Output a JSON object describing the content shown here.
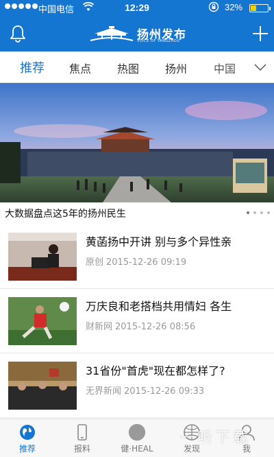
{
  "status_bar": {
    "carrier": "中国电信",
    "time": "12:29",
    "battery_percent": "32%",
    "battery_level": 0.32,
    "battery_fill_color": "#f2d200"
  },
  "header": {
    "logo_title": "扬州发布",
    "logo_subtitle": "VOICE OF YANGZHOU",
    "bell_icon": "bell-icon",
    "plus_icon": "plus-icon",
    "background_color": "#1476d1"
  },
  "tabs": [
    {
      "label": "推荐",
      "active": true
    },
    {
      "label": "焦点",
      "active": false
    },
    {
      "label": "热图",
      "active": false
    },
    {
      "label": "扬州",
      "active": false
    },
    {
      "label": "中国",
      "active": false
    }
  ],
  "banner": {
    "caption": "大数据盘点这5年的扬州民生",
    "slide_count": 4,
    "active_slide": 1
  },
  "news": [
    {
      "title": "黄菡扬中开讲 别与多个异性亲",
      "source": "原创",
      "datetime": "2015-12-26 09:19"
    },
    {
      "title": "万庆良和老搭档共用情妇 各生",
      "source": "财新网",
      "datetime": "2015-12-26 08:56"
    },
    {
      "title": "31省份\"首虎\"现在都怎样了?",
      "source": "无界新闻",
      "datetime": "2015-12-26 09:33"
    }
  ],
  "bottom_nav": [
    {
      "label": "推荐",
      "icon": "globe-icon",
      "active": true
    },
    {
      "label": "报料",
      "icon": "phone-icon",
      "active": false
    },
    {
      "label": "健·HEAL",
      "icon": "health-icon",
      "active": false
    },
    {
      "label": "发现",
      "icon": "discover-icon",
      "active": false
    },
    {
      "label": "我",
      "icon": "user-icon",
      "active": false
    }
  ],
  "watermark": "一听下载",
  "accent_color": "#1476d1"
}
